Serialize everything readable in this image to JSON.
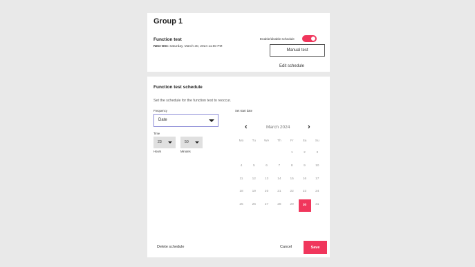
{
  "group": {
    "title": "Group 1",
    "function_test_label": "Function test",
    "next_test_prefix": "Next test:",
    "next_test_value": "Saturday, March 30, 2024 11:50 PM",
    "toggle_label": "Enable/disable schedule",
    "toggle_on": true,
    "manual_test_label": "Manual test",
    "edit_schedule_label": "Edit schedule"
  },
  "schedule": {
    "title": "Function test schedule",
    "description": "Set the schedule for the function test to reoccur.",
    "frequency_label": "Frequency",
    "frequency_value": "Date",
    "time_label": "Time",
    "hours_value": "23",
    "hours_label": "Hours",
    "minutes_value": "50",
    "minutes_label": "Minutes",
    "start_date_label": "Set start date",
    "calendar": {
      "month_label": "March 2024",
      "weekdays": [
        "Mo",
        "Tu",
        "We",
        "Th",
        "Fr",
        "Sa",
        "Su"
      ],
      "weeks": [
        [
          "",
          "",
          "",
          "",
          "1",
          "2",
          "3"
        ],
        [
          "4",
          "5",
          "6",
          "7",
          "8",
          "9",
          "10"
        ],
        [
          "11",
          "12",
          "13",
          "14",
          "15",
          "16",
          "17"
        ],
        [
          "18",
          "19",
          "20",
          "21",
          "22",
          "23",
          "24"
        ],
        [
          "25",
          "26",
          "27",
          "28",
          "29",
          "30",
          "31"
        ]
      ],
      "selected_day": "30"
    },
    "delete_label": "Delete schedule",
    "cancel_label": "Cancel",
    "save_label": "Save"
  },
  "colors": {
    "accent": "#f0365c",
    "background": "#e9e9e9",
    "card": "#ffffff"
  },
  "icons": {
    "prev": "chevron-left-icon",
    "next": "chevron-right-icon",
    "dropdown": "caret-down-icon"
  }
}
